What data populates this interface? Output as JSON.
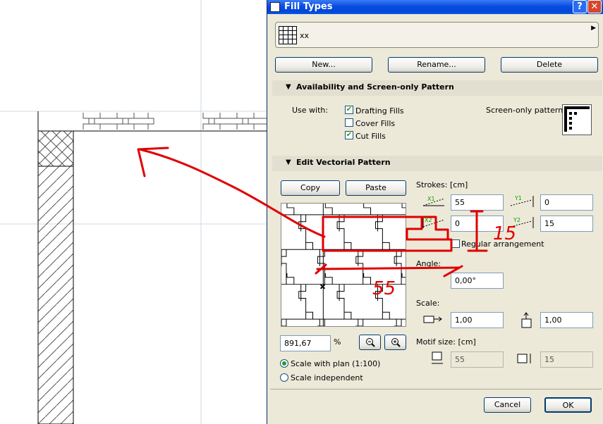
{
  "dialog": {
    "title": "Fill Types",
    "help_label": "?",
    "close_label": "✕",
    "selected_fill": "xx",
    "buttons": {
      "new": "New...",
      "rename": "Rename...",
      "delete": "Delete"
    }
  },
  "availability": {
    "header": "Availability and Screen-only Pattern",
    "use_with_label": "Use with:",
    "options": [
      {
        "label": "Drafting Fills",
        "checked": true
      },
      {
        "label": "Cover Fills",
        "checked": false
      },
      {
        "label": "Cut Fills",
        "checked": true
      }
    ],
    "screen_pattern_label": "Screen-only pattern:"
  },
  "vectorial": {
    "header": "Edit Vectorial Pattern",
    "copy_label": "Copy",
    "paste_label": "Paste",
    "strokes_label": "Strokes: [cm]",
    "x1_icon": "X1",
    "y1_icon": "Y1",
    "x2_icon": "X2",
    "y2_icon": "Y2",
    "x1": "55",
    "y1": "0",
    "x2": "0",
    "y2": "15",
    "regular_arrangement_label": "Regular arrangement",
    "regular_arrangement_checked": false,
    "angle_label": "Angle:",
    "angle": "0,00°",
    "scale_label": "Scale:",
    "scale_x": "1,00",
    "scale_y": "1,00",
    "motif_label": "Motif size: [cm]",
    "motif_x": "55",
    "motif_y": "15",
    "zoom_value": "891,67",
    "zoom_unit": "%",
    "scale_with_plan_label": "Scale with plan (1:100)",
    "scale_independent_label": "Scale independent",
    "scale_with_plan_selected": true
  },
  "footer": {
    "cancel": "Cancel",
    "ok": "OK"
  },
  "annotations": {
    "height_note": "15",
    "width_note": "55",
    "color": "#e00000"
  },
  "colors": {
    "title_bar": "#0a4ce0",
    "dialog_bg": "#ece9d8",
    "check_green": "#21a121"
  }
}
